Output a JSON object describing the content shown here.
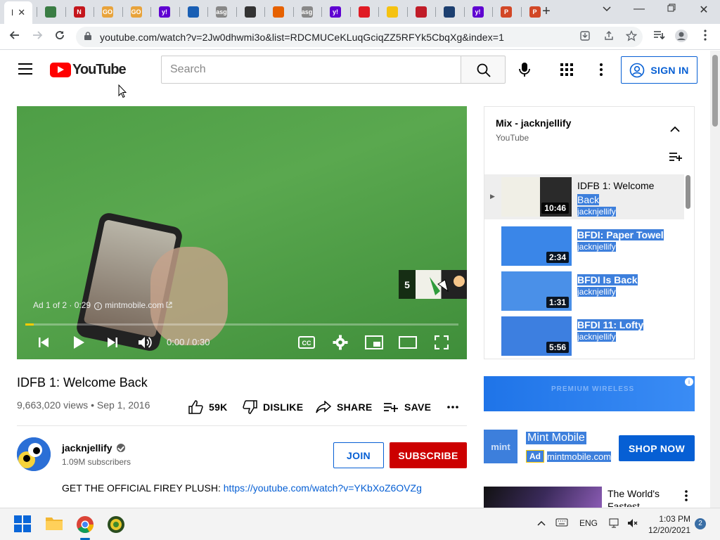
{
  "browser": {
    "active_tab": {
      "title": "I",
      "close": "✕"
    },
    "tabs": [
      {
        "icon": "cat-favicon",
        "color": "#3a7d44",
        "label": ""
      },
      {
        "icon": "n-favicon",
        "color": "#c4161c",
        "label": "N"
      },
      {
        "icon": "go-favicon",
        "color": "#e8a33b",
        "label": "GO"
      },
      {
        "icon": "go-favicon",
        "color": "#e8a33b",
        "label": "GO"
      },
      {
        "icon": "yahoo-favicon",
        "color": "#5f01d1",
        "label": "y!"
      },
      {
        "icon": "circle-favicon",
        "color": "#1a5fb4",
        "label": ""
      },
      {
        "icon": "asg-favicon",
        "color": "#888888",
        "label": "asg"
      },
      {
        "icon": "globe-favicon",
        "color": "#333333",
        "label": ""
      },
      {
        "icon": "rainbow-favicon",
        "color": "#e66100",
        "label": ""
      },
      {
        "icon": "asg-favicon",
        "color": "#888888",
        "label": "asg"
      },
      {
        "icon": "yahoo-favicon",
        "color": "#5f01d1",
        "label": "y!"
      },
      {
        "icon": "target-favicon",
        "color": "#e01b24",
        "label": ""
      },
      {
        "icon": "bird-favicon",
        "color": "#f5c211",
        "label": ""
      },
      {
        "icon": "cloud-favicon",
        "color": "#c01c28",
        "label": ""
      },
      {
        "icon": "book-favicon",
        "color": "#1c3f70",
        "label": ""
      },
      {
        "icon": "yahoo-favicon",
        "color": "#5f01d1",
        "label": "y!"
      },
      {
        "icon": "ppt-favicon",
        "color": "#d24726",
        "label": "P"
      },
      {
        "icon": "ppt-favicon",
        "color": "#d24726",
        "label": "P"
      }
    ],
    "new_tab": "+",
    "url": "youtube.com/watch?v=2Jw0dhwmi3o&list=RDCMUCeKLuqGciqZZ5RFYk5CbqXg&index=1"
  },
  "youtube": {
    "logo_text": "YouTube",
    "search_placeholder": "Search",
    "sign_in": "SIGN IN",
    "player": {
      "ad_label": "Ad 1 of 2 · 0:29",
      "ad_domain": "mintmobile.com",
      "skip_count": "5",
      "time": "0:00 / 0:30",
      "progress_fraction": 0.02
    },
    "video": {
      "title": "IDFB 1: Welcome Back",
      "views_date": "9,663,020 views • Sep 1, 2016",
      "likes": "59K",
      "dislike": "DISLIKE",
      "share": "SHARE",
      "save": "SAVE"
    },
    "channel": {
      "name": "jacknjellify",
      "subscribers": "1.09M subscribers",
      "join": "JOIN",
      "subscribe": "SUBSCRIBE"
    },
    "description": {
      "text": "GET THE OFFICIAL FIREY PLUSH: ",
      "link": "https://youtube.com/watch?v=YKbXoZ6OVZg"
    },
    "playlist": {
      "title": "Mix - jacknjellify",
      "subtitle": "YouTube",
      "items": [
        {
          "title_a": "IDFB 1: Welcome",
          "title_b": "Back",
          "channel": "jacknjellify",
          "duration": "10:46"
        },
        {
          "title_a": "BFDI: Paper Towel",
          "title_b": "",
          "channel": "jacknjellify",
          "duration": "2:34"
        },
        {
          "title_a": "BFDI Is Back",
          "title_b": "",
          "channel": "jacknjellify",
          "duration": "1:31"
        },
        {
          "title_a": "BFDI 11: Lofty",
          "title_b": "",
          "channel": "jacknjellify",
          "duration": "5:56"
        }
      ]
    },
    "ad": {
      "banner_text": "PREMIUM WIRELESS",
      "name": "Mint Mobile",
      "tag": "Ad",
      "domain": "mintmobile.com",
      "cta": "SHOP NOW",
      "logo": "mint"
    },
    "next_video": {
      "title": "The World's Fastest"
    }
  },
  "taskbar": {
    "language": "ENG",
    "time": "1:03 PM",
    "date": "12/20/2021",
    "notifications": "2"
  }
}
